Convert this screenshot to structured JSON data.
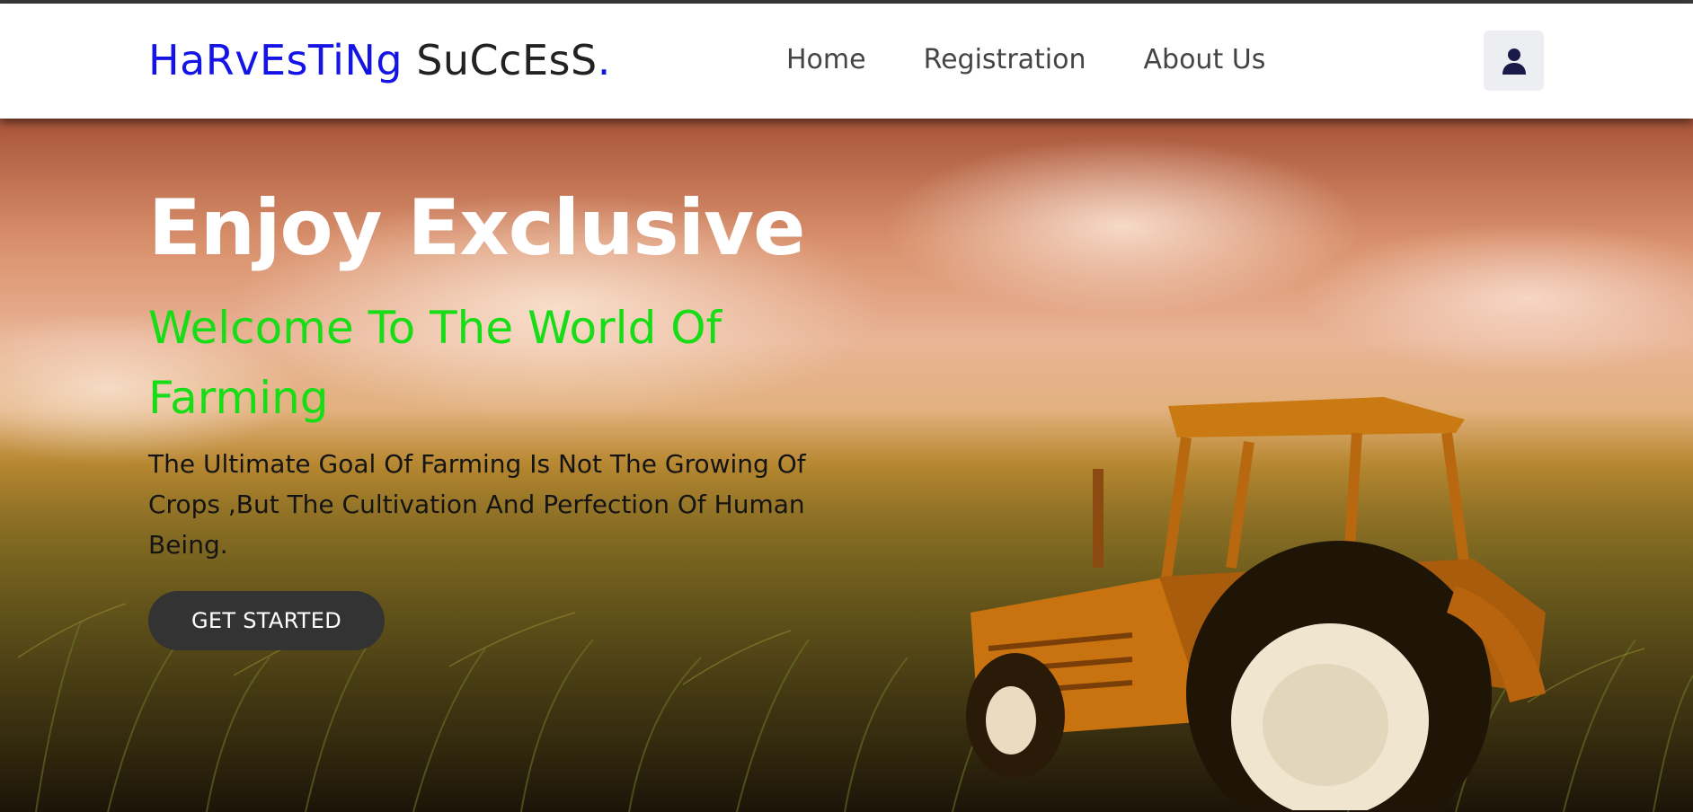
{
  "brand": {
    "part1": "HaRvEsTiNg",
    "part2": "SuCcEsS",
    "dot": "."
  },
  "nav": {
    "items": [
      {
        "label": "Home"
      },
      {
        "label": "Registration"
      },
      {
        "label": "About Us"
      }
    ],
    "user_icon": "user-icon"
  },
  "hero": {
    "title": "Enjoy Exclusive",
    "subtitle": "Welcome To The World Of Farming",
    "description": "The Ultimate Goal Of Farming Is Not The Growing Of Crops ,But The Cultivation And Perfection Of Human Being.",
    "cta_label": "GET STARTED"
  },
  "colors": {
    "brand_blue": "#1414e6",
    "subtitle_green": "#16dd16",
    "button_dark": "#333333"
  }
}
